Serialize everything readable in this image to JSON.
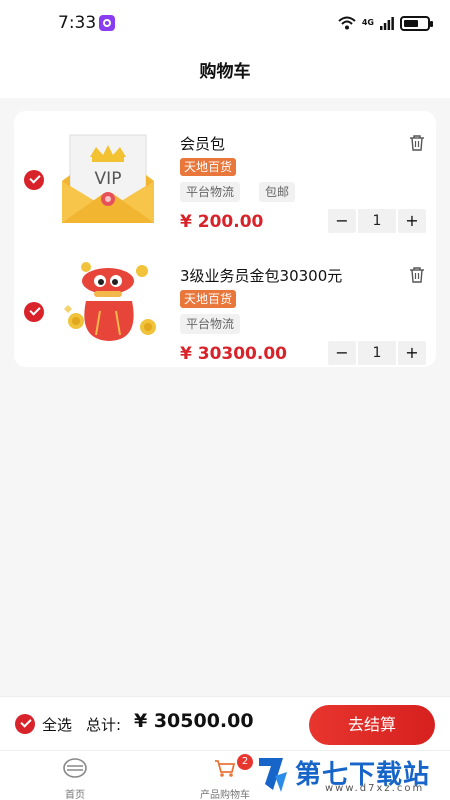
{
  "status_bar": {
    "time": "7:33",
    "network": "4G"
  },
  "header": {
    "title": "购物车"
  },
  "cart": {
    "items": [
      {
        "name": "会员包",
        "store_tag": "天地百货",
        "tags": [
          "平台物流",
          "包邮"
        ],
        "price": "¥ 200.00",
        "quantity": "1",
        "selected": true,
        "image": "vip-envelope"
      },
      {
        "name": "3级业务员金包30300元",
        "store_tag": "天地百货",
        "tags": [
          "平台物流"
        ],
        "price": "¥ 30300.00",
        "quantity": "1",
        "selected": true,
        "image": "red-lucky-bag"
      }
    ],
    "stepper": {
      "minus": "−",
      "plus": "+"
    }
  },
  "checkout": {
    "select_all_label": "全选",
    "total_label": "总计:",
    "total_value": "¥ 30500.00",
    "button_label": "去结算"
  },
  "tab_bar": {
    "tabs": [
      {
        "label": "首页",
        "icon": "home-icon"
      },
      {
        "label": "产品购物车",
        "icon": "cart-icon",
        "badge": "2"
      }
    ]
  },
  "watermark": {
    "title": "第七下载站",
    "url": "www.d7xz.com"
  },
  "colors": {
    "accent": "#d8232a",
    "store_tag": "#e9763a",
    "background": "#f6f6f6"
  }
}
